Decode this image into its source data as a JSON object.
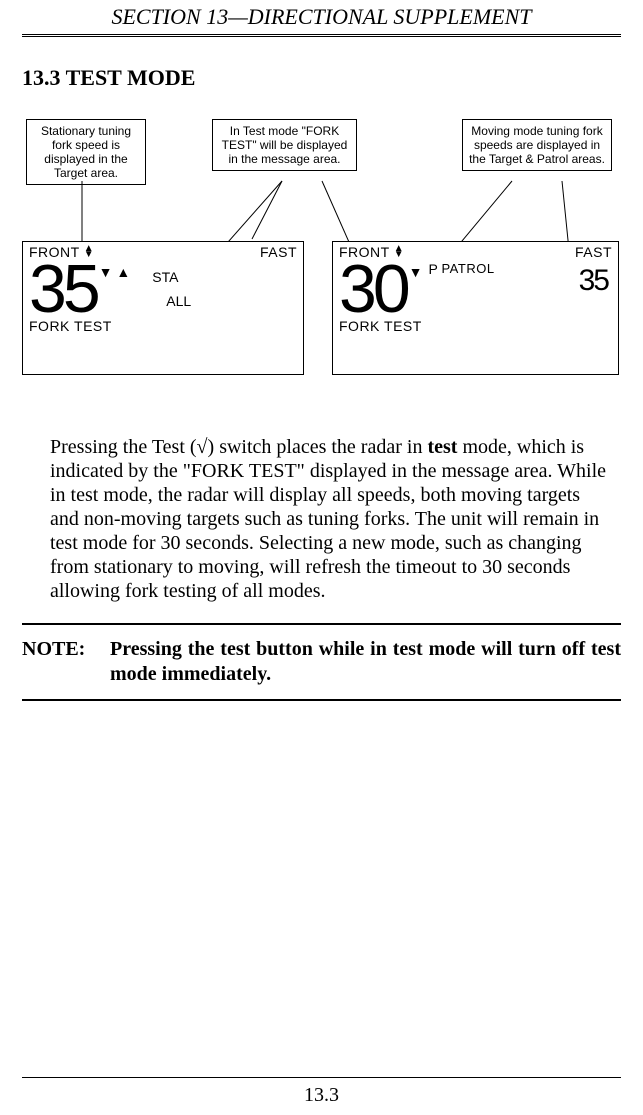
{
  "header": "SECTION 13—DIRECTIONAL SUPPLEMENT",
  "section_title": "13.3 TEST MODE",
  "callouts": {
    "left": "Stationary tuning fork speed is displayed in the Target area.",
    "mid": "In Test mode \"FORK TEST\" will be displayed in the message area.",
    "right": "Moving mode tuning fork speeds are displayed in the Target & Patrol areas."
  },
  "displays": {
    "left": {
      "front": "FRONT",
      "fast": "FAST",
      "speed": "35",
      "mode1": "STA",
      "mode2": "ALL",
      "bottom": "FORK TEST"
    },
    "right": {
      "front": "FRONT",
      "fast": "FAST",
      "speed": "30",
      "p": "P",
      "patrol_label": "PATROL",
      "patrol_speed": "35",
      "bottom": "FORK TEST"
    }
  },
  "body": {
    "p1a": "Pressing the Test (√) switch places the radar in ",
    "p1b": "test",
    "p1c": " mode, which is indicated by the \"FORK TEST\" displayed in the message area. While in test mode, the radar will display all speeds, both moving targets and non-moving targets such as tuning forks. The unit will remain in test mode for 30 seconds. Selecting a new mode, such as changing from stationary to moving, will refresh the timeout to 30 seconds allowing fork testing of all modes."
  },
  "note": {
    "label": "NOTE:",
    "text": "Pressing the test button while in test mode will turn off test mode immediately."
  },
  "page_number": "13.3"
}
